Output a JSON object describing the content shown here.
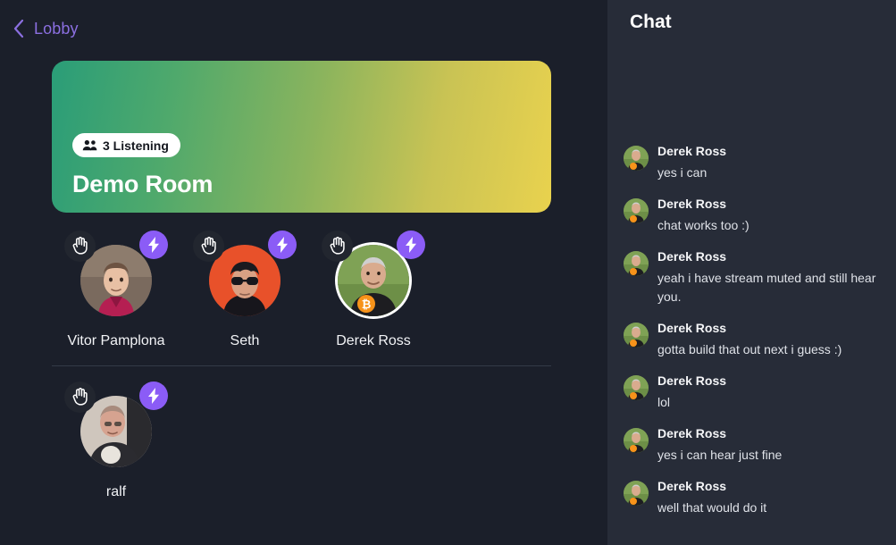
{
  "topbar": {
    "back_icon": "chevron-left-icon",
    "back_label": "Lobby",
    "accent_color": "#8b6fe0"
  },
  "room_card": {
    "gradient_from": "#2a9d78",
    "gradient_to": "#e9d24e",
    "listening_icon": "people-icon",
    "listening_label": "3 Listening",
    "listening_count": 3,
    "title": "Demo Room"
  },
  "speakers": [
    {
      "name": "Vitor Pamplona",
      "hand_icon": "raised-hand-icon",
      "bolt_icon": "lightning-bolt-icon",
      "speaking": false,
      "avatar_bg": "#6d5a52",
      "avatar_alt": "avatar-vitor-pamplona"
    },
    {
      "name": "Seth",
      "hand_icon": "raised-hand-icon",
      "bolt_icon": "lightning-bolt-icon",
      "speaking": false,
      "avatar_bg": "#e8512a",
      "avatar_alt": "avatar-seth"
    },
    {
      "name": "Derek Ross",
      "hand_icon": "raised-hand-icon",
      "bolt_icon": "lightning-bolt-icon",
      "speaking": true,
      "avatar_bg": "#6f8f4a",
      "avatar_alt": "avatar-derek-ross"
    }
  ],
  "listeners": [
    {
      "name": "ralf",
      "hand_icon": "raised-hand-icon",
      "bolt_icon": "lightning-bolt-icon",
      "speaking": false,
      "avatar_bg": "#5d5a62",
      "avatar_alt": "avatar-ralf"
    }
  ],
  "chat": {
    "title": "Chat",
    "messages": [
      {
        "author": "Derek Ross",
        "text": "yes i can"
      },
      {
        "author": "Derek Ross",
        "text": "chat works too :)"
      },
      {
        "author": "Derek Ross",
        "text": "yeah i have stream muted and still hear you."
      },
      {
        "author": "Derek Ross",
        "text": "gotta build that out next i guess :)"
      },
      {
        "author": "Derek Ross",
        "text": "lol"
      },
      {
        "author": "Derek Ross",
        "text": "yes i can hear just fine"
      },
      {
        "author": "Derek Ross",
        "text": "well that would do it"
      }
    ]
  },
  "theme": {
    "background": "#1b1f2a",
    "chat_background": "#272c38",
    "accent_purple": "#8b5cf6",
    "divider": "#343a47"
  }
}
